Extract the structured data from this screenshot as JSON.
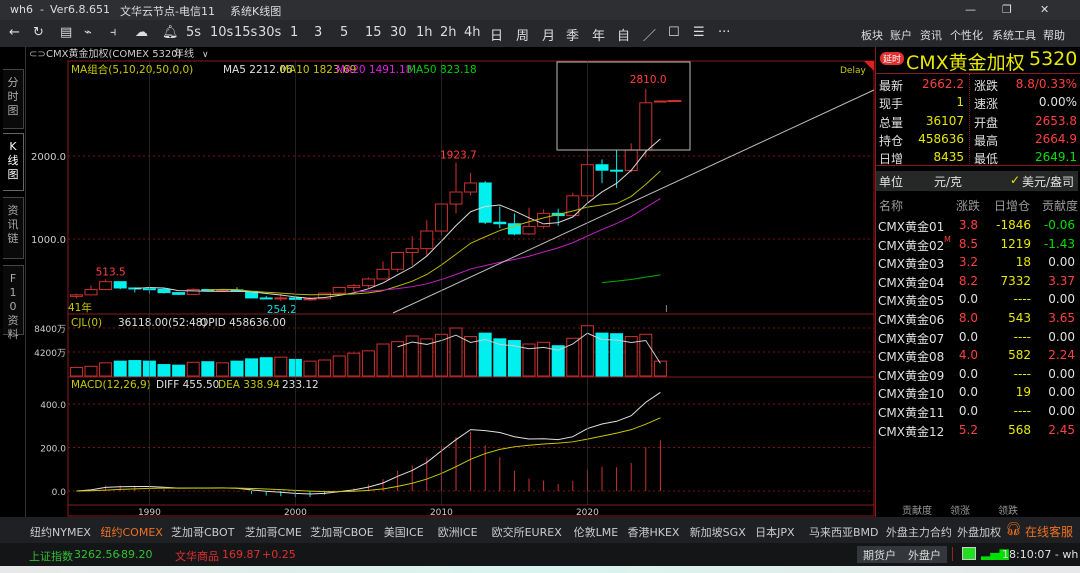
{
  "window": {
    "app": "wh6",
    "sep": "-",
    "version": "Ver6.8.651",
    "node": "文华云节点-电信11",
    "view": "系统K线图"
  },
  "toolbar": {
    "periods": [
      "5s",
      "10s",
      "15s",
      "30s",
      "1",
      "3",
      "5",
      "15",
      "30",
      "1h",
      "2h",
      "4h",
      "日",
      "周",
      "月",
      "季",
      "年",
      "自"
    ],
    "menus": [
      "板块",
      "账户",
      "资讯",
      "个性化",
      "系统工具",
      "帮助"
    ],
    "more": "···"
  },
  "left_tabs": [
    "分时图",
    "K线图",
    "资讯链",
    "F10资料"
  ],
  "chart": {
    "instrument": "CMX黄金加权(COMEX 5320)",
    "period": "年线",
    "ma_label": "MA组合(5,10,20,50,0,0)",
    "ma5": "MA5 2212.06",
    "ma10": "MA10 1823.69",
    "ma20": "MA20 1491.18",
    "ma50": "MA50 823.18",
    "delay": "Delay",
    "count_label": "41年",
    "price_ticks": [
      "2000.0",
      "1000.0"
    ],
    "high_labels": [
      "513.5",
      "1923.7",
      "2810.0"
    ],
    "low_label": "254.2",
    "vol_label": "CJL(0)",
    "vol_value": "36118.00(52:48)",
    "opid": "OPID 458636.00",
    "vol_ticks": [
      "8400万",
      "4200万"
    ],
    "macd_label": "MACD(12,26,9)",
    "diff": "DIFF 455.50",
    "dea": "DEA 338.94",
    "macd": "233.12",
    "macd_ticks": [
      "400.0",
      "200.0",
      "0.0"
    ],
    "year_ticks": [
      "1990",
      "2000",
      "2010",
      "2020"
    ],
    "colors": {
      "up": "#d03030",
      "down": "#00f0f0",
      "ma5": "#d8d8d8",
      "ma10": "#b8b800",
      "ma20": "#c020c0",
      "ma50": "#00b000"
    },
    "start_year": 1985,
    "ohlc": [
      [
        309,
        341,
        284,
        327
      ],
      [
        327,
        442,
        326,
        391
      ],
      [
        391,
        513.5,
        390,
        486
      ],
      [
        486,
        486,
        395,
        410
      ],
      [
        410,
        418,
        356,
        401
      ],
      [
        401,
        424,
        345,
        394
      ],
      [
        394,
        403,
        344,
        354
      ],
      [
        354,
        360,
        329,
        333
      ],
      [
        333,
        407,
        326,
        391
      ],
      [
        391,
        397,
        370,
        383
      ],
      [
        383,
        397,
        372,
        387
      ],
      [
        387,
        418,
        367,
        369
      ],
      [
        369,
        368,
        283,
        290
      ],
      [
        290,
        313,
        273,
        288
      ],
      [
        288,
        339,
        254.2,
        290
      ],
      [
        290,
        317,
        263,
        273
      ],
      [
        273,
        299,
        255,
        279
      ],
      [
        279,
        350,
        277,
        348
      ],
      [
        348,
        417,
        320,
        416
      ],
      [
        416,
        457,
        373,
        438
      ],
      [
        438,
        538,
        411,
        518
      ],
      [
        518,
        730,
        518,
        635
      ],
      [
        635,
        845,
        603,
        838
      ],
      [
        838,
        1033,
        681,
        884
      ],
      [
        884,
        1227,
        801,
        1096
      ],
      [
        1096,
        1431,
        1044,
        1421
      ],
      [
        1421,
        1923.7,
        1308,
        1566
      ],
      [
        1566,
        1796,
        1527,
        1675
      ],
      [
        1675,
        1697,
        1180,
        1202
      ],
      [
        1202,
        1392,
        1131,
        1184
      ],
      [
        1184,
        1307,
        1046,
        1061
      ],
      [
        1061,
        1377,
        1046,
        1152
      ],
      [
        1152,
        1358,
        1124,
        1309
      ],
      [
        1309,
        1366,
        1160,
        1282
      ],
      [
        1282,
        1557,
        1266,
        1520
      ],
      [
        1520,
        2089,
        1451,
        1895
      ],
      [
        1895,
        1959,
        1673,
        1829
      ],
      [
        1829,
        2078,
        1615,
        1826
      ],
      [
        1826,
        2152,
        1804,
        2071
      ],
      [
        2071,
        2810,
        1984,
        2641
      ],
      [
        2653.8,
        2664.9,
        2649.1,
        2662.2
      ]
    ],
    "volume_wan": [
      1500,
      1700,
      2300,
      2600,
      2700,
      2600,
      2000,
      1900,
      2400,
      2500,
      2300,
      2600,
      3000,
      3200,
      3300,
      2900,
      2600,
      2800,
      3500,
      4000,
      4400,
      5600,
      6000,
      7000,
      6500,
      7300,
      8400,
      6900,
      7500,
      6500,
      6200,
      5600,
      5900,
      5300,
      6600,
      8800,
      7500,
      7400,
      6900,
      7300,
      2600
    ]
  },
  "quote": {
    "badge": "延时",
    "title": "CMX黄金加权",
    "code": "5320",
    "rows": [
      [
        "最新",
        "2662.2",
        "涨跌",
        "8.8/0.33%"
      ],
      [
        "现手",
        "1",
        "速涨",
        "0.00%"
      ],
      [
        "总量",
        "36107",
        "开盘",
        "2653.8"
      ],
      [
        "持仓",
        "458636",
        "最高",
        "2664.9"
      ],
      [
        "日增",
        "8435",
        "最低",
        "2649.1"
      ]
    ],
    "unit_label": "单位",
    "unit_a": "元/克",
    "unit_b": "美元/盎司"
  },
  "contracts": {
    "headers": [
      "名称",
      "涨跌",
      "日增仓",
      "贡献度"
    ],
    "rows": [
      [
        "CMX黄金01",
        "3.8",
        "-1846",
        "-0.06"
      ],
      [
        "CMX黄金02",
        "8.5",
        "1219",
        "-1.43"
      ],
      [
        "CMX黄金03",
        "3.2",
        "18",
        "0.00"
      ],
      [
        "CMX黄金04",
        "8.2",
        "7332",
        "3.37"
      ],
      [
        "CMX黄金05",
        "0.0",
        "----",
        "0.00"
      ],
      [
        "CMX黄金06",
        "8.0",
        "543",
        "3.65"
      ],
      [
        "CMX黄金07",
        "0.0",
        "----",
        "0.00"
      ],
      [
        "CMX黄金08",
        "4.0",
        "582",
        "2.24"
      ],
      [
        "CMX黄金09",
        "0.0",
        "----",
        "0.00"
      ],
      [
        "CMX黄金10",
        "0.0",
        "19",
        "0.00"
      ],
      [
        "CMX黄金11",
        "0.0",
        "----",
        "0.00"
      ],
      [
        "CMX黄金12",
        "5.2",
        "568",
        "2.45"
      ]
    ],
    "main_mark": "M",
    "tabs": [
      "贡献度",
      "领涨",
      "领跌"
    ]
  },
  "exchanges": [
    "纽约NYMEX",
    "纽约COMEX",
    "芝加哥CBOT",
    "芝加哥CME",
    "芝加哥CBOE",
    "美国ICE",
    "欧洲ICE",
    "欧交所EUREX",
    "伦敦LME",
    "香港HKEX",
    "新加坡SGX",
    "日本JPX",
    "马来西亚BMD",
    "外盘主力合约",
    "外盘加权"
  ],
  "support": "在线客服",
  "status": {
    "idx1_name": "上证指数",
    "idx1_val": "3262.56",
    "idx1_chg": "-89.20",
    "idx2_name": "文华商品",
    "idx2_val": "169.87",
    "idx2_chg": "+0.25",
    "btn1": "期货户",
    "btn2": "外盘户",
    "time": "18:10:07 - wh"
  }
}
